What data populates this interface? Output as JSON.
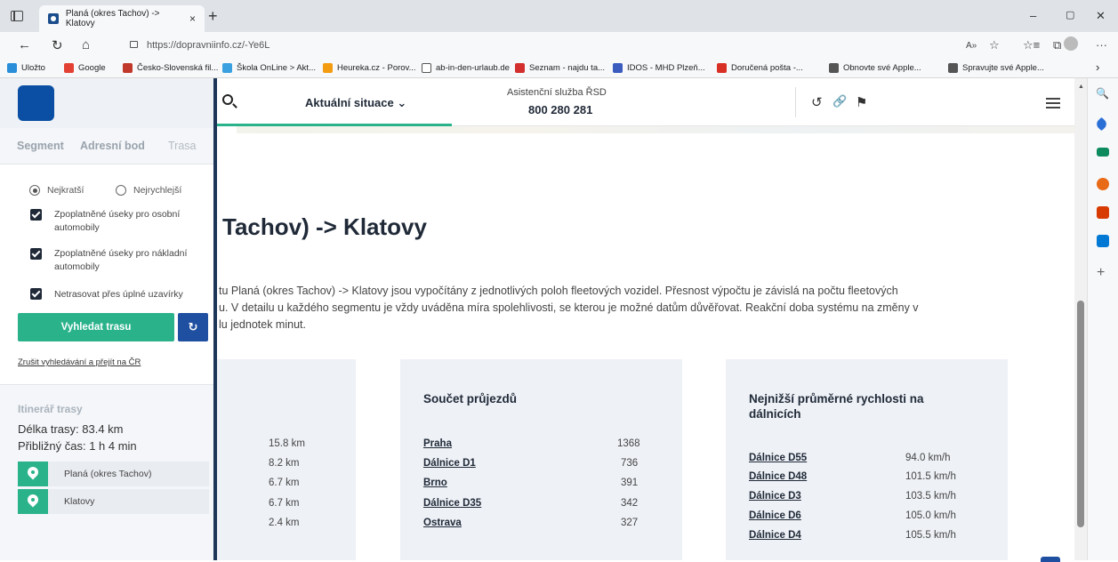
{
  "browser": {
    "tab_title": "Planá (okres Tachov) -> Klatovy",
    "tab_close": "×",
    "new_tab": "+",
    "url": "https://dopravniinfo.cz/-Ye6L",
    "window": {
      "minimize": "–",
      "restore": "▢",
      "close": "✕"
    },
    "nav": {
      "back": "←",
      "reload": "↻",
      "home": "⌂"
    },
    "addr_icons": {
      "read_aloud": "A»",
      "favorite": "☆",
      "favorites": "☆≡",
      "collections": "⧉",
      "more": "···"
    },
    "bookmarks": [
      {
        "label": "Uložto",
        "color": "#2a8fd8"
      },
      {
        "label": "Google",
        "color": "#e34133"
      },
      {
        "label": "Česko-Slovenská fil...",
        "color": "#c0392b"
      },
      {
        "label": "Škola OnLine > Akt...",
        "color": "#3aa0e0"
      },
      {
        "label": "Heureka.cz - Porov...",
        "color": "#f39c12"
      },
      {
        "label": "ab-in-den-urlaub.de",
        "color": "#ffffff"
      },
      {
        "label": "Seznam - najdu ta...",
        "color": "#d32f2f"
      },
      {
        "label": "IDOS - MHD Plzeň...",
        "color": "#3b5bbf"
      },
      {
        "label": "Doručená pošta -...",
        "color": "#d93025"
      },
      {
        "label": "Obnovte své Apple...",
        "color": "#555555"
      },
      {
        "label": "Spravujte své Apple...",
        "color": "#555555"
      }
    ],
    "bookmarks_more": "›"
  },
  "header": {
    "nav_label": "Aktuální situace",
    "nav_chevron": "⌄",
    "assist_label": "Asistenční služba ŘSD",
    "assist_phone": "800 280 281",
    "icons": {
      "refresh": "↺",
      "link": "🔗",
      "flag": "⚑"
    }
  },
  "panel": {
    "tabs": [
      "Segment",
      "Adresní bod",
      "Trasa"
    ],
    "radio": [
      {
        "label": "Nejkratší",
        "selected": true
      },
      {
        "label": "Nejrychlejší",
        "selected": false
      }
    ],
    "checkboxes": [
      "Zpoplatněné úseky pro osobní automobily",
      "Zpoplatněné úseky pro nákladní automobily",
      "Netrasovat přes úplné uzavírky"
    ],
    "find_button": "Vyhledat trasu",
    "refresh_icon": "↻",
    "cancel_link": "Zrušit vyhledávání a přejít na ČR",
    "itinerary": {
      "title": "Itinerář trasy",
      "length": "Délka trasy: 83.4 km",
      "time": "Přibližný čas: 1 h 4 min",
      "stops": [
        "Planá (okres Tachov)",
        "Klatovy"
      ]
    }
  },
  "main": {
    "title": "Tachov) -> Klatovy",
    "description": [
      "tu Planá (okres Tachov) -> Klatovy jsou vypočítány z jednotlivých poloh fleetových vozidel. Přesnost výpočtu je závislá na počtu fleetových",
      "u. V detailu u každého segmentu je vždy uváděna míra spolehlivosti, se kterou je možné datům důvěřovat. Reakční doba systému na změny v",
      "lu jednotek minut."
    ],
    "card1": {
      "distances": [
        "15.8 km",
        "8.2 km",
        "6.7 km",
        "6.7 km",
        "2.4 km"
      ]
    },
    "card2": {
      "title": "Součet průjezdů",
      "rows": [
        {
          "name": "Praha",
          "value": "1368"
        },
        {
          "name": "Dálnice D1",
          "value": "736"
        },
        {
          "name": "Brno",
          "value": "391"
        },
        {
          "name": "Dálnice D35",
          "value": "342"
        },
        {
          "name": "Ostrava",
          "value": "327"
        }
      ]
    },
    "card3": {
      "title_line1": "Nejnižší průměrné rychlosti na",
      "title_line2": "dálnicích",
      "rows": [
        {
          "name": "Dálnice D55",
          "value": "94.0 km/h"
        },
        {
          "name": "Dálnice D48",
          "value": "101.5 km/h"
        },
        {
          "name": "Dálnice D3",
          "value": "103.5 km/h"
        },
        {
          "name": "Dálnice D6",
          "value": "105.0 km/h"
        },
        {
          "name": "Dálnice D4",
          "value": "105.5 km/h"
        }
      ]
    }
  },
  "edge_sidebar": {
    "search": "🔍",
    "add": "+",
    "colors": [
      "#1a73e8",
      "#2a6fd6",
      "#0e8a5f",
      "#e86a17",
      "#d83b01",
      "#0078d4"
    ]
  }
}
